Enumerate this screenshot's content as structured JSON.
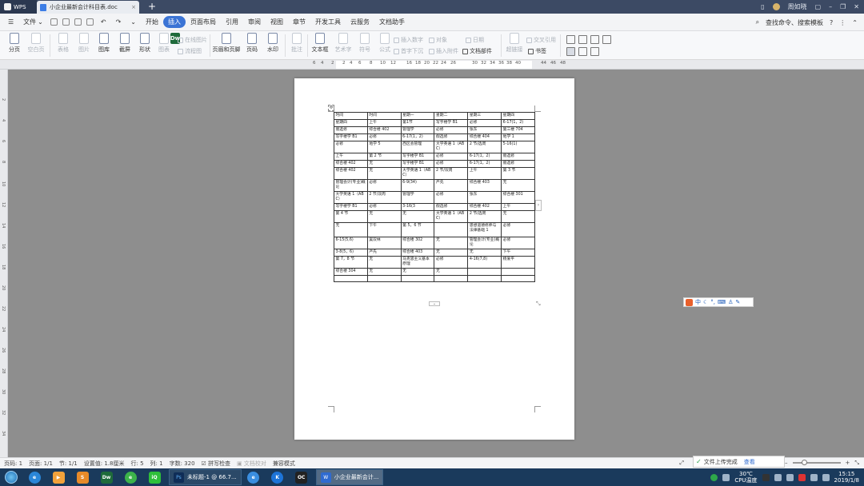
{
  "titlebar": {
    "app_name": "WPS",
    "doc_tab": "小企业最新会计科目表.doc",
    "new_tab": "+",
    "user_name": "周如晓",
    "help": "?"
  },
  "menubar": {
    "file": "文件",
    "tabs": [
      "开始",
      "插入",
      "页面布局",
      "引用",
      "审阅",
      "视图",
      "章节",
      "开发工具",
      "云服务",
      "文档助手"
    ],
    "active_tab": 1,
    "search": "查找命令、搜索模板"
  },
  "ribbon": {
    "pagebreak": "分页",
    "blankpage": "空白页",
    "table": "表格",
    "picture": "图片",
    "graphic": "图库",
    "screenshot": "截屏",
    "shape": "形状",
    "icons": "图表",
    "online_image": "在线图片",
    "flowchart": "流程图",
    "mindmap": "思维导图",
    "header_footer": "页眉和页脚",
    "page_number": "页码",
    "watermark": "水印",
    "comment": "批注",
    "textbox": "文本框",
    "art_text": "艺术字",
    "symbol": "符号",
    "formula": "公式",
    "insert_number": "插入数字",
    "object": "对象",
    "date": "日期",
    "first_letter": "首字下沉",
    "attachment": "插入附件",
    "doc_parts": "文档部件",
    "hyperlink": "超链接",
    "cross_ref": "交叉引用",
    "bookmark": "书签"
  },
  "ruler": {
    "h_numbers": [
      "6",
      "4",
      "2",
      "2",
      "4",
      "6",
      "8",
      "10",
      "12",
      "16",
      "18",
      "20",
      "22",
      "24",
      "26",
      "30",
      "32",
      "34",
      "36",
      "38",
      "40",
      "44",
      "46",
      "48"
    ],
    "v_numbers": [
      "2",
      "4",
      "6",
      "8",
      "10",
      "12",
      "14",
      "16",
      "18",
      "20",
      "22",
      "24",
      "26",
      "28",
      "30",
      "32",
      "34"
    ]
  },
  "table": {
    "rows": [
      [
        "时间",
        "时间",
        "星期一",
        "星期二",
        "星期三",
        "星期四"
      ],
      [
        "星期四",
        "上午",
        "第1节",
        "写字楼学 B1",
        "必修",
        "6-17(1，2)"
      ],
      [
        "假选修",
        "综合楼 402",
        "管理学",
        "必修",
        "张东",
        "第三楼 704"
      ],
      [
        "写字楼学 B1",
        "必修",
        "6-17(1，2)",
        "假选修",
        "综合楼 404",
        "地学 1"
      ],
      [
        "必修",
        "地学 5",
        "西区会管理",
        "大学英语 1（ABC）",
        "2 节/选周",
        "5-16(1)"
      ],
      [
        "上午",
        "第 2 节",
        "写字楼学 B1",
        "必修",
        "6-17(1，2)",
        "假选修"
      ],
      [
        "综合楼 402",
        "无",
        "写字楼学 B1",
        "必修",
        "6-17(1，2)",
        "假选修"
      ],
      [
        "综合楼 402",
        "无",
        "大学英语 1（ABC）",
        "2 节/双周",
        "上午",
        "第 3 节"
      ],
      [
        "管理会计(专业)概论",
        "必修",
        "6-9(34)",
        "严先",
        "综合楼 403",
        "无"
      ],
      [
        "大学英语 1（ABC）",
        "2 节/双周",
        "管理学",
        "必修",
        "张东",
        "综合楼 301"
      ],
      [
        "写字楼学 B1",
        "必修",
        "3-16(3",
        "假选修",
        "综合楼 402",
        "上午"
      ],
      [
        "第 4 节",
        "无",
        "无",
        "大学英语 1（ABC）",
        "2 节/选周",
        "无"
      ],
      [
        "无",
        "下午",
        "第 5，6 节",
        "",
        "思想道德修养与法律基础 1",
        "必修"
      ],
      [
        "6-15(5,6)",
        "吴双林",
        "综合楼 302",
        "无",
        "管理会计(专业)概论",
        "必修"
      ],
      [
        "3-8(5，6)",
        "严先",
        "综合楼 403",
        "无",
        "无",
        "下午"
      ],
      [
        "第 7，8 节",
        "无",
        "马克思主义基本原理",
        "必修",
        "4-16(7,8)",
        "杨爱平"
      ],
      [
        "综合楼 304",
        "无",
        "无",
        "无",
        "",
        ""
      ],
      [
        "",
        "",
        "",
        "",
        "",
        ""
      ]
    ]
  },
  "ime": {
    "lang": "中"
  },
  "statusbar": {
    "page_no": "页码: 1",
    "pages": "页面: 1/1",
    "section": "节: 1/1",
    "position": "设置值: 1.8厘米",
    "line": "行: 5",
    "col": "列: 1",
    "words": "字数: 320",
    "spell": "拼写检查",
    "doc_check": "文档校对",
    "compat": "兼容模式",
    "upload": "文件上传完成",
    "view_link": "查看",
    "zoom_fraction": 0.2
  },
  "taskbar": {
    "windows": [
      {
        "label": "未标题-1 @ 66.7...",
        "icon": "Ps"
      },
      {
        "label": "小企业最新会计...",
        "icon": "W",
        "active": true
      }
    ],
    "weather": "30℃",
    "cpu": "CPU温度",
    "time": "15:15",
    "date": "2019/1/8"
  }
}
